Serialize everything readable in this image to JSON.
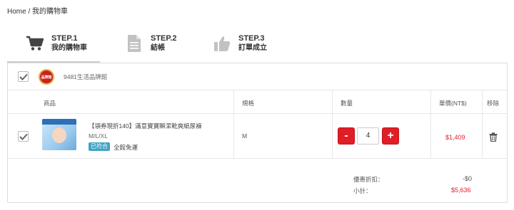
{
  "breadcrumb": {
    "home": "Home",
    "separator": " / ",
    "current": "我的購物車"
  },
  "steps": [
    {
      "number": "STEP.1",
      "title": "我的購物車",
      "icon": "shopping-cart-icon",
      "active": true
    },
    {
      "number": "STEP.2",
      "title": "結帳",
      "icon": "document-icon",
      "active": false
    },
    {
      "number": "STEP.3",
      "title": "訂單成立",
      "icon": "thumbs-up-icon",
      "active": false
    }
  ],
  "shop": {
    "name": "9481生活品牌館",
    "logo_text": "品牌館",
    "checked": true
  },
  "table": {
    "headers": {
      "product": "商品",
      "spec": "規格",
      "quantity": "數量",
      "unit_price": "單價(NT$)",
      "remove": "移除"
    }
  },
  "item": {
    "checked": true,
    "title": "【領券現折140】滿意寶寶瞬潔乾爽紙尿褲",
    "size_options": "M/L/XL",
    "badge": "已符合",
    "shipping": "全館免運",
    "spec": "M",
    "quantity": "4",
    "minus_label": "-",
    "plus_label": "+",
    "price": "$1,409"
  },
  "summary": {
    "discount_label": "優惠折扣：",
    "discount_value": "-$0",
    "subtotal_label": "小計：",
    "subtotal_value": "$5,636"
  },
  "colors": {
    "accent": "#e01e26",
    "badge": "#3fa3c4"
  }
}
